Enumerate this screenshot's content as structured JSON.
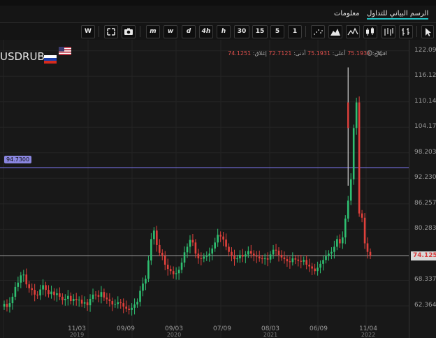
{
  "tabs": [
    {
      "label": "الرسم البياني للتداول",
      "active": true
    },
    {
      "label": "معلومات",
      "active": false
    }
  ],
  "toolbar": {
    "timeframes": [
      "m",
      "w",
      "d",
      "4h",
      "h",
      "30",
      "15",
      "5",
      "1"
    ],
    "left_buttons": [
      {
        "label": "W",
        "icon": "watchlist-icon"
      },
      {
        "label": "",
        "icon": "fullscreen-icon"
      },
      {
        "label": "",
        "icon": "camera-icon"
      }
    ],
    "chart_type_icons": [
      "dots-chart-icon",
      "area-chart-icon",
      "line-chart-icon",
      "candles-chart-icon",
      "bars-chart-icon",
      "ohlc-chart-icon",
      "cursor-icon"
    ]
  },
  "chart": {
    "symbol": "USDRUB",
    "ohlc_labels": {
      "open": "افتتاح:",
      "high": "أعلى:",
      "low": "أدنى:",
      "close": "إغلاق:"
    },
    "ohlc_values": {
      "open": "75.1931",
      "high": "75.1931",
      "low": "72.7121",
      "close": "74.1251"
    },
    "current_price": "74.1251",
    "horizontal_line_label": "94.7300",
    "colors": {
      "up": "#2fbf71",
      "down": "#e0403b",
      "hline": "#6a66c8",
      "price_line": "#9a9a9a"
    }
  },
  "chart_data": {
    "type": "candlestick",
    "y_ticks": [
      "122.096",
      "116.123",
      "110.149",
      "104.176",
      "98.2035",
      "92.2303",
      "86.2571",
      "80.2839",
      "74.1251",
      "68.3375",
      "62.3643"
    ],
    "x_ticks": [
      {
        "label": "11/03",
        "year": "2019"
      },
      {
        "label": "09/09",
        "year": ""
      },
      {
        "label": "09/03",
        "year": "2020"
      },
      {
        "label": "07/09",
        "year": ""
      },
      {
        "label": "08/03",
        "year": "2021"
      },
      {
        "label": "06/09",
        "year": ""
      },
      {
        "label": "11/04",
        "year": "2022"
      }
    ],
    "ylim": [
      58.6,
      124.0
    ],
    "horizontal_lines": [
      94.73,
      74.1251
    ],
    "close_series": [
      62.8,
      62.1,
      63.0,
      64.5,
      66.8,
      67.8,
      69.5,
      69.7,
      67.4,
      66.5,
      66.1,
      65.0,
      64.8,
      66.2,
      67.2,
      66.1,
      65.1,
      65.7,
      64.9,
      65.3,
      64.5,
      63.7,
      64.0,
      64.7,
      63.5,
      64.0,
      63.7,
      63.8,
      62.9,
      63.2,
      62.5,
      64.0,
      65.0,
      64.9,
      64.5,
      65.6,
      64.3,
      63.9,
      63.5,
      62.7,
      62.8,
      63.2,
      63.0,
      62.2,
      61.7,
      61.4,
      61.9,
      62.7,
      63.3,
      65.9,
      67.6,
      68.7,
      73.0,
      78.0,
      80.0,
      76.6,
      74.8,
      74.1,
      72.0,
      71.0,
      70.5,
      69.8,
      70.0,
      70.8,
      72.5,
      74.9,
      76.2,
      77.8,
      77.2,
      74.6,
      73.5,
      73.4,
      73.9,
      74.0,
      74.6,
      75.8,
      77.2,
      79.0,
      78.6,
      77.9,
      76.2,
      75.0,
      74.1,
      73.3,
      73.5,
      74.3,
      73.9,
      74.4,
      75.2,
      74.6,
      74.1,
      73.9,
      73.5,
      73.3,
      73.5,
      73.2,
      74.4,
      75.5,
      75.3,
      74.3,
      73.7,
      73.3,
      72.8,
      72.6,
      73.5,
      73.2,
      72.9,
      72.7,
      73.1,
      72.0,
      71.6,
      71.1,
      70.5,
      71.3,
      72.2,
      73.1,
      74.0,
      74.6,
      75.0,
      76.2,
      78.0,
      77.0,
      78.4,
      82.8,
      87.0,
      92.0,
      104.0,
      110.0,
      84.0,
      83.0,
      77.0,
      75.0,
      74.1251
    ]
  }
}
